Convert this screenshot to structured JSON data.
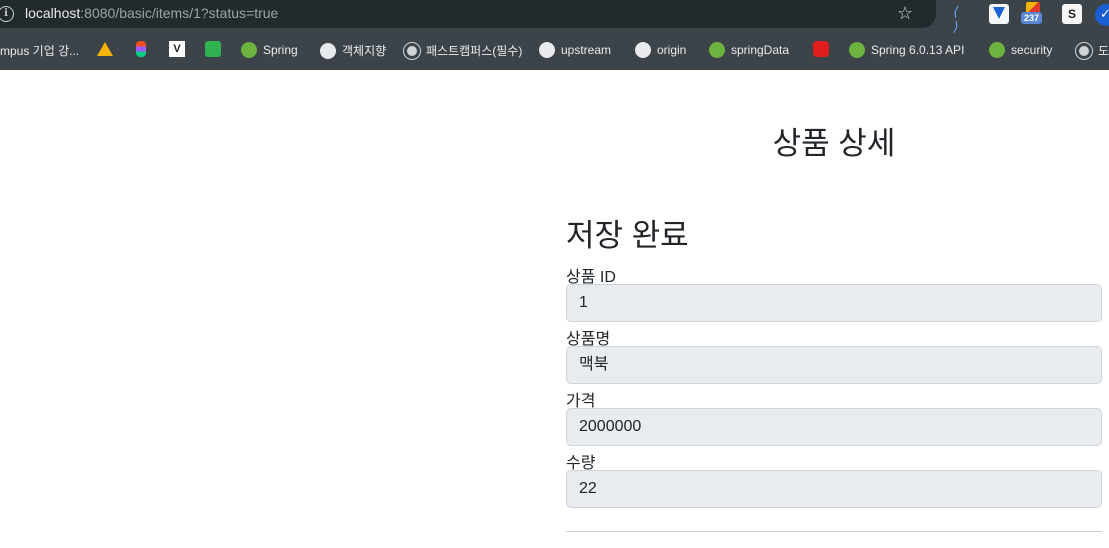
{
  "browser": {
    "url_host": "localhost",
    "url_rest": ":8080/basic/items/1?status=true",
    "extensions": {
      "ext1_label": "⟨ ⟩",
      "badge_count": "237",
      "ext4_label": "S"
    },
    "bookmarks": [
      {
        "label": "mpus 기업 강...",
        "icon": "globe-icon"
      },
      {
        "label": "Spring",
        "icon": "spring-icon"
      },
      {
        "label": "객체지향",
        "icon": "github-icon"
      },
      {
        "label": "패스트캠퍼스(필수)",
        "icon": "globe-icon"
      },
      {
        "label": "upstream",
        "icon": "github-icon"
      },
      {
        "label": "origin",
        "icon": "github-icon"
      },
      {
        "label": "springData",
        "icon": "spring-icon"
      },
      {
        "label": "Spring 6.0.13 API",
        "icon": "spring-icon"
      },
      {
        "label": "security",
        "icon": "spring-icon"
      },
      {
        "label": "도",
        "icon": "globe-icon"
      }
    ],
    "vbox_label": "V"
  },
  "page": {
    "title": "상품 상세",
    "status_message": "저장 완료",
    "fields": {
      "id": {
        "label": "상품 ID",
        "value": "1"
      },
      "name": {
        "label": "상품명",
        "value": "맥북"
      },
      "price": {
        "label": "가격",
        "value": "2000000"
      },
      "quantity": {
        "label": "수량",
        "value": "22"
      }
    }
  }
}
